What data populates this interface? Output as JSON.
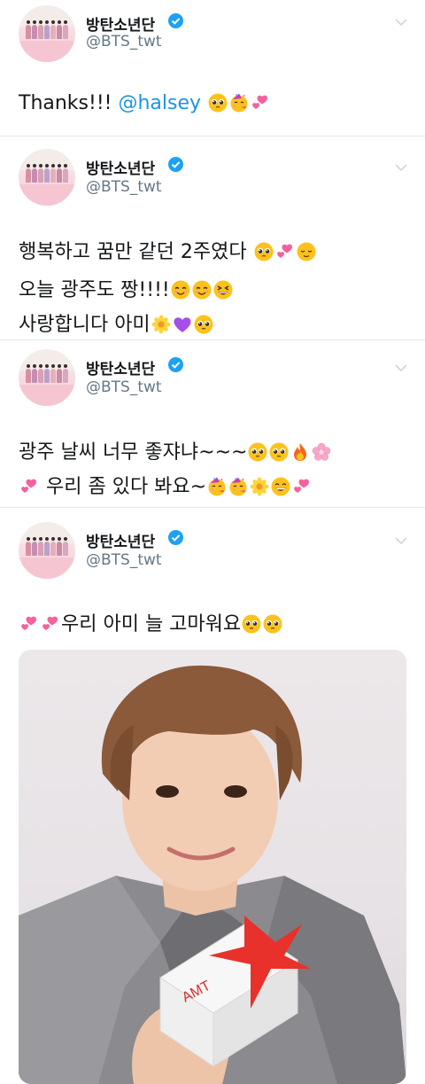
{
  "tweets": [
    {
      "account": {
        "name": "방탄소년단",
        "handle": "@BTS_twt"
      },
      "lines": [
        {
          "prefix": "Thanks!!! ",
          "mention": "@halsey"
        }
      ]
    },
    {
      "account": {
        "name": "방탄소년단",
        "handle": "@BTS_twt"
      },
      "lines": [
        {
          "text": "행복하고 꿈만 같던 2주였다 "
        },
        {
          "text": "오늘 광주도 짱!!!!"
        },
        {
          "text": "사랑합니다 아미"
        }
      ]
    },
    {
      "account": {
        "name": "방탄소년단",
        "handle": "@BTS_twt"
      },
      "lines": [
        {
          "text": "광주 날씨 너무 좋쟈냐~~~"
        },
        {
          "text": " 우리 좀 있다 봐요~"
        }
      ]
    },
    {
      "account": {
        "name": "방탄소년단",
        "handle": "@BTS_twt"
      },
      "lines": [
        {
          "text": "우리 아미 늘 고마워요"
        }
      ],
      "photo": {
        "box_text": "AMT"
      }
    }
  ],
  "icons": {
    "verified": "verified-badge-icon",
    "menu": "chevron-down-icon",
    "emoji_set": [
      "pleading-face",
      "partying-face",
      "two-hearts",
      "relieved-face",
      "smiling-face",
      "grinning-squinting-face",
      "blossom",
      "purple-heart",
      "fire",
      "cherry-blossom",
      "grinning-face"
    ]
  },
  "colors": {
    "mention": "#1b95e0",
    "verified": "#1da1f2",
    "handle": "#657786",
    "divider": "#e1e8ed"
  }
}
